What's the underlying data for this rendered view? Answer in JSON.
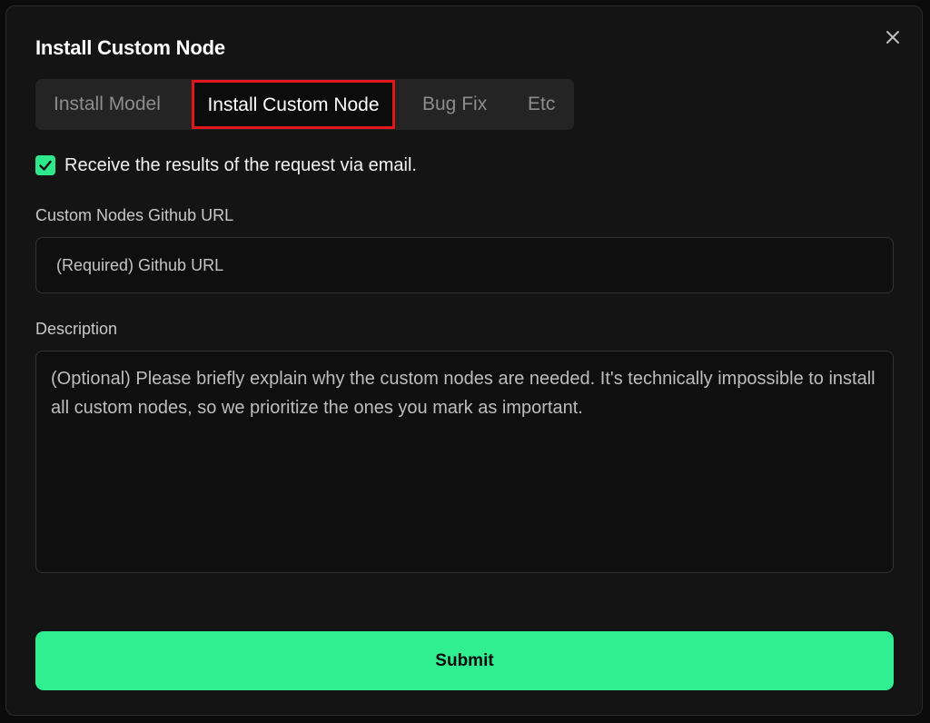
{
  "modal": {
    "title": "Install Custom Node",
    "close_icon": "close-icon"
  },
  "tabs": [
    {
      "label": "Install Model",
      "selected": false
    },
    {
      "label": "Install Custom Node",
      "selected": true
    },
    {
      "label": "Bug Fix",
      "selected": false
    },
    {
      "label": "Etc",
      "selected": false
    }
  ],
  "email_option": {
    "label": "Receive the results of the request via email.",
    "checked": true,
    "icon": "checkmark-icon"
  },
  "github_url": {
    "label": "Custom Nodes Github URL",
    "placeholder": "(Required) Github URL",
    "value": ""
  },
  "description": {
    "label": "Description",
    "placeholder": "(Optional) Please briefly explain why the custom nodes are needed. It's technically impossible to install all custom nodes, so we prioritize the ones you mark as important.",
    "value": ""
  },
  "submit": {
    "label": "Submit"
  },
  "colors": {
    "accent": "#2fef92",
    "selected_tab_outline": "#e3161b",
    "modal_background": "#141414"
  }
}
